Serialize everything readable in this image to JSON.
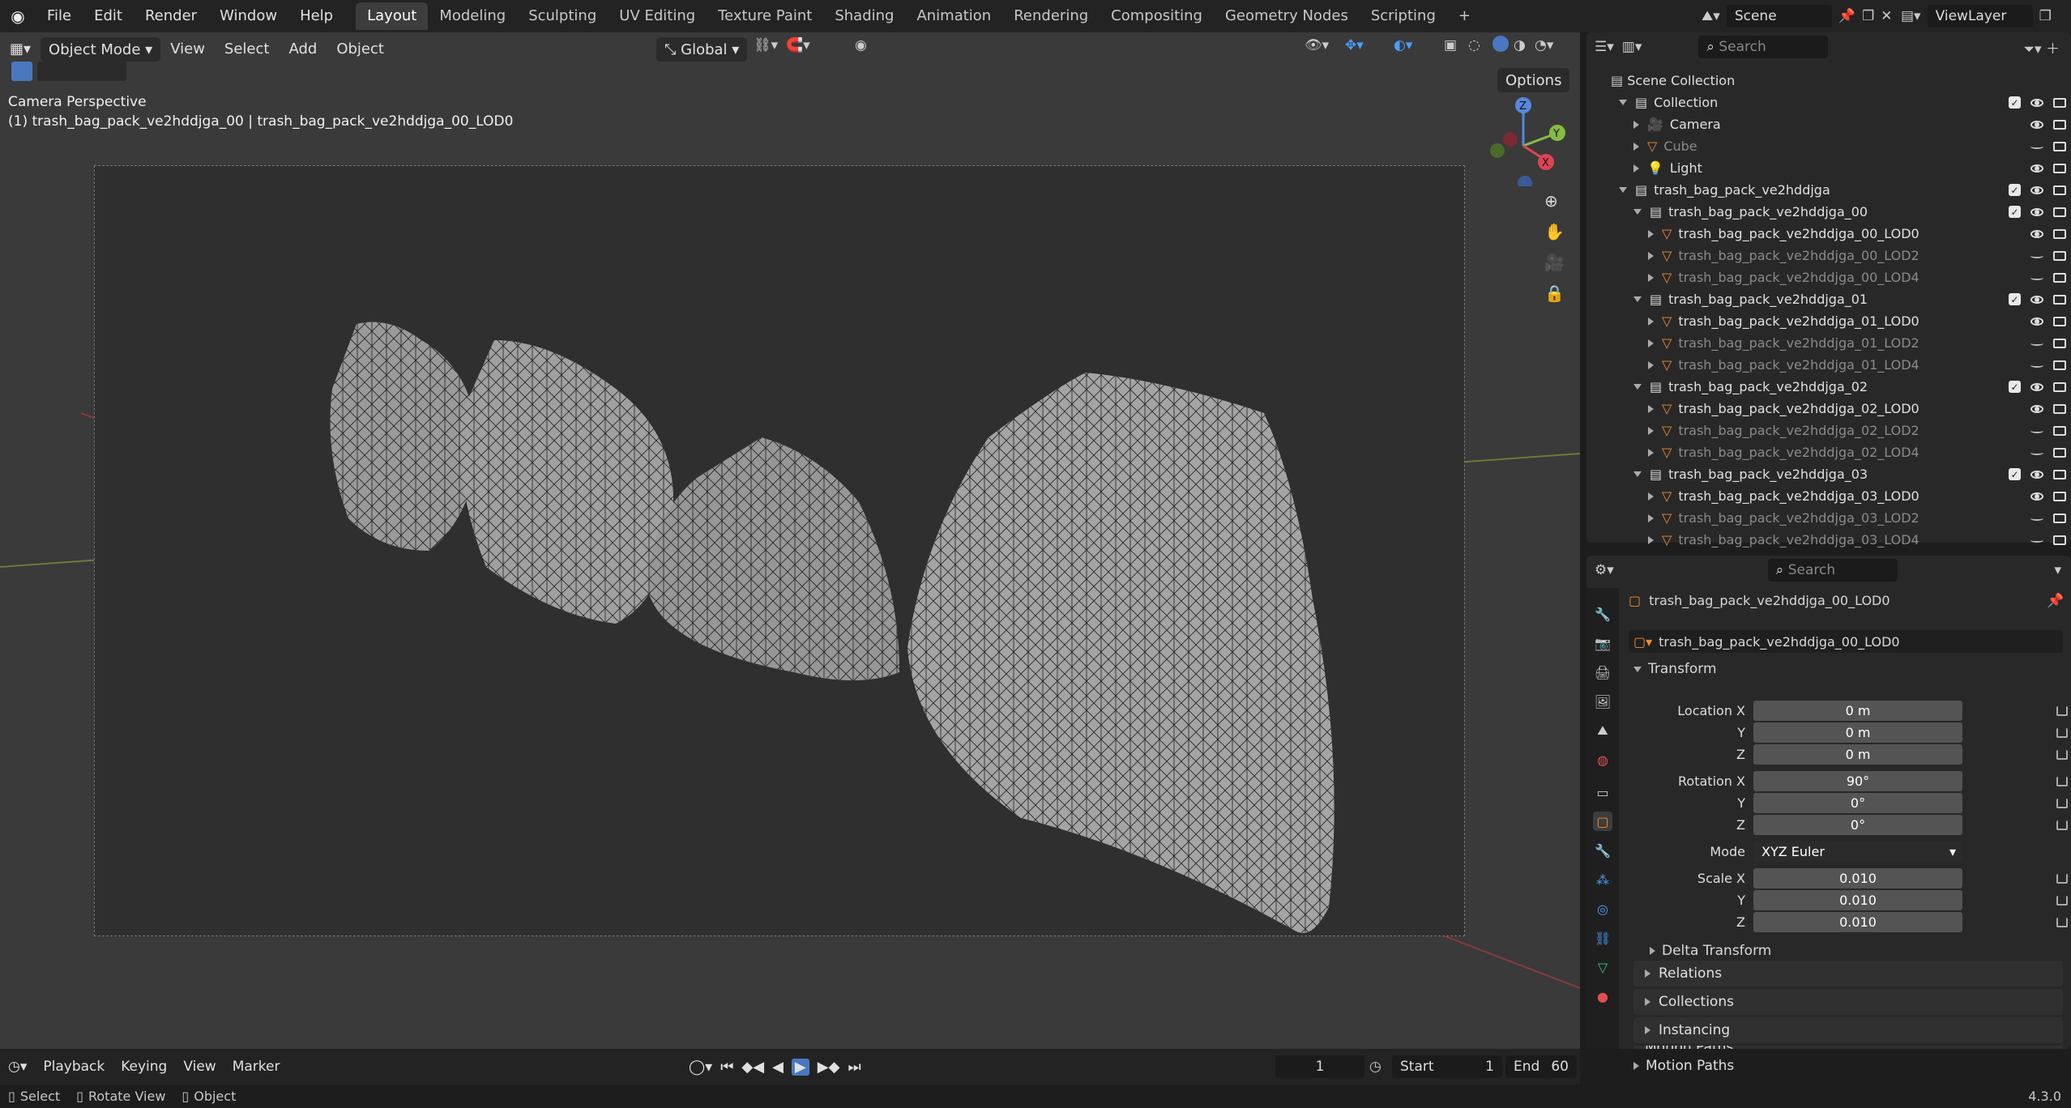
{
  "topbar": {
    "menu": [
      "File",
      "Edit",
      "Render",
      "Window",
      "Help"
    ],
    "workspaces": [
      "Layout",
      "Modeling",
      "Sculpting",
      "UV Editing",
      "Texture Paint",
      "Shading",
      "Animation",
      "Rendering",
      "Compositing",
      "Geometry Nodes",
      "Scripting"
    ],
    "active_workspace": "Layout",
    "add_tab": "+",
    "scene": "Scene",
    "view_layer": "ViewLayer"
  },
  "viewport": {
    "mode": "Object Mode",
    "menus": [
      "View",
      "Select",
      "Add",
      "Object"
    ],
    "transform_orientation": "Global",
    "options": "Options",
    "camera_label": "Camera Perspective",
    "object_label": "(1) trash_bag_pack_ve2hddjga_00 | trash_bag_pack_ve2hddjga_00_LOD0",
    "gizmo": {
      "x": "X",
      "y": "Y",
      "z": "Z"
    }
  },
  "outliner": {
    "search_placeholder": "Search",
    "root": "Scene Collection",
    "rows": [
      {
        "label": "Collection",
        "indent": 1,
        "type": "collection",
        "dim": false
      },
      {
        "label": "Camera",
        "indent": 2,
        "type": "camera",
        "dim": false
      },
      {
        "label": "Cube",
        "indent": 2,
        "type": "mesh",
        "dim": true
      },
      {
        "label": "Light",
        "indent": 2,
        "type": "light",
        "dim": false
      },
      {
        "label": "trash_bag_pack_ve2hddjga",
        "indent": 1,
        "type": "collection",
        "dim": false
      },
      {
        "label": "trash_bag_pack_ve2hddjga_00",
        "indent": 2,
        "type": "collection",
        "dim": false
      },
      {
        "label": "trash_bag_pack_ve2hddjga_00_LOD0",
        "indent": 3,
        "type": "mesh",
        "dim": false
      },
      {
        "label": "trash_bag_pack_ve2hddjga_00_LOD2",
        "indent": 3,
        "type": "mesh",
        "dim": true
      },
      {
        "label": "trash_bag_pack_ve2hddjga_00_LOD4",
        "indent": 3,
        "type": "mesh",
        "dim": true
      },
      {
        "label": "trash_bag_pack_ve2hddjga_01",
        "indent": 2,
        "type": "collection",
        "dim": false
      },
      {
        "label": "trash_bag_pack_ve2hddjga_01_LOD0",
        "indent": 3,
        "type": "mesh",
        "dim": false
      },
      {
        "label": "trash_bag_pack_ve2hddjga_01_LOD2",
        "indent": 3,
        "type": "mesh",
        "dim": true
      },
      {
        "label": "trash_bag_pack_ve2hddjga_01_LOD4",
        "indent": 3,
        "type": "mesh",
        "dim": true
      },
      {
        "label": "trash_bag_pack_ve2hddjga_02",
        "indent": 2,
        "type": "collection",
        "dim": false
      },
      {
        "label": "trash_bag_pack_ve2hddjga_02_LOD0",
        "indent": 3,
        "type": "mesh",
        "dim": false
      },
      {
        "label": "trash_bag_pack_ve2hddjga_02_LOD2",
        "indent": 3,
        "type": "mesh",
        "dim": true
      },
      {
        "label": "trash_bag_pack_ve2hddjga_02_LOD4",
        "indent": 3,
        "type": "mesh",
        "dim": true
      },
      {
        "label": "trash_bag_pack_ve2hddjga_03",
        "indent": 2,
        "type": "collection",
        "dim": false
      },
      {
        "label": "trash_bag_pack_ve2hddjga_03_LOD0",
        "indent": 3,
        "type": "mesh",
        "dim": false
      },
      {
        "label": "trash_bag_pack_ve2hddjga_03_LOD2",
        "indent": 3,
        "type": "mesh",
        "dim": true
      },
      {
        "label": "trash_bag_pack_ve2hddjga_03_LOD4",
        "indent": 3,
        "type": "mesh",
        "dim": true
      }
    ]
  },
  "properties": {
    "search_placeholder": "Search",
    "object_name": "trash_bag_pack_ve2hddjga_00_LOD0",
    "datablock_name": "trash_bag_pack_ve2hddjga_00_LOD0",
    "transform_title": "Transform",
    "location": {
      "label_x": "Location X",
      "label_y": "Y",
      "label_z": "Z",
      "x": "0 m",
      "y": "0 m",
      "z": "0 m"
    },
    "rotation": {
      "label_x": "Rotation X",
      "label_y": "Y",
      "label_z": "Z",
      "x": "90°",
      "y": "0°",
      "z": "0°"
    },
    "mode_label": "Mode",
    "mode_value": "XYZ Euler",
    "scale": {
      "label_x": "Scale X",
      "label_y": "Y",
      "label_z": "Z",
      "x": "0.010",
      "y": "0.010",
      "z": "0.010"
    },
    "delta_transform": "Delta Transform",
    "panels": [
      "Relations",
      "Collections",
      "Instancing",
      "Motion Paths"
    ]
  },
  "timeline": {
    "menus": [
      "Playback",
      "Keying",
      "View",
      "Marker"
    ],
    "current_frame": "1",
    "start_label": "Start",
    "start": "1",
    "end_label": "End",
    "end": "60"
  },
  "status": {
    "select": "Select",
    "rotate": "Rotate View",
    "object": "Object",
    "version": "4.3.0"
  }
}
